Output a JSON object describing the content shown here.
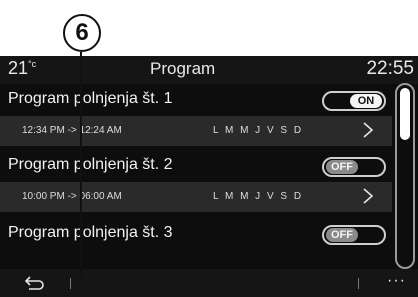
{
  "callout": {
    "number": "6"
  },
  "header": {
    "temperature": "21",
    "temperature_unit": "°c",
    "title": "Program",
    "time": "22:55"
  },
  "programs": [
    {
      "label": "Program polnjenja št. 1",
      "toggle": "ON",
      "state": "on",
      "schedule": {
        "time": "12:34 PM -> 12:24 AM",
        "days": "L M M J V S D"
      }
    },
    {
      "label": "Program polnjenja št. 2",
      "toggle": "OFF",
      "state": "off",
      "schedule": {
        "time": "10:00 PM -> 06:00 AM",
        "days": "L M M J V S D"
      }
    },
    {
      "label": "Program polnjenja št. 3",
      "toggle": "OFF",
      "state": "off"
    }
  ],
  "icons": {
    "back": "back-arrow-icon",
    "next": "chevron-right-icon",
    "more": "more-icon"
  },
  "bottom": {
    "more": "···"
  },
  "colors": {
    "background": "#0d0d0d",
    "schedule_row": "#2a2a2a",
    "text": "#f2f2f2"
  }
}
